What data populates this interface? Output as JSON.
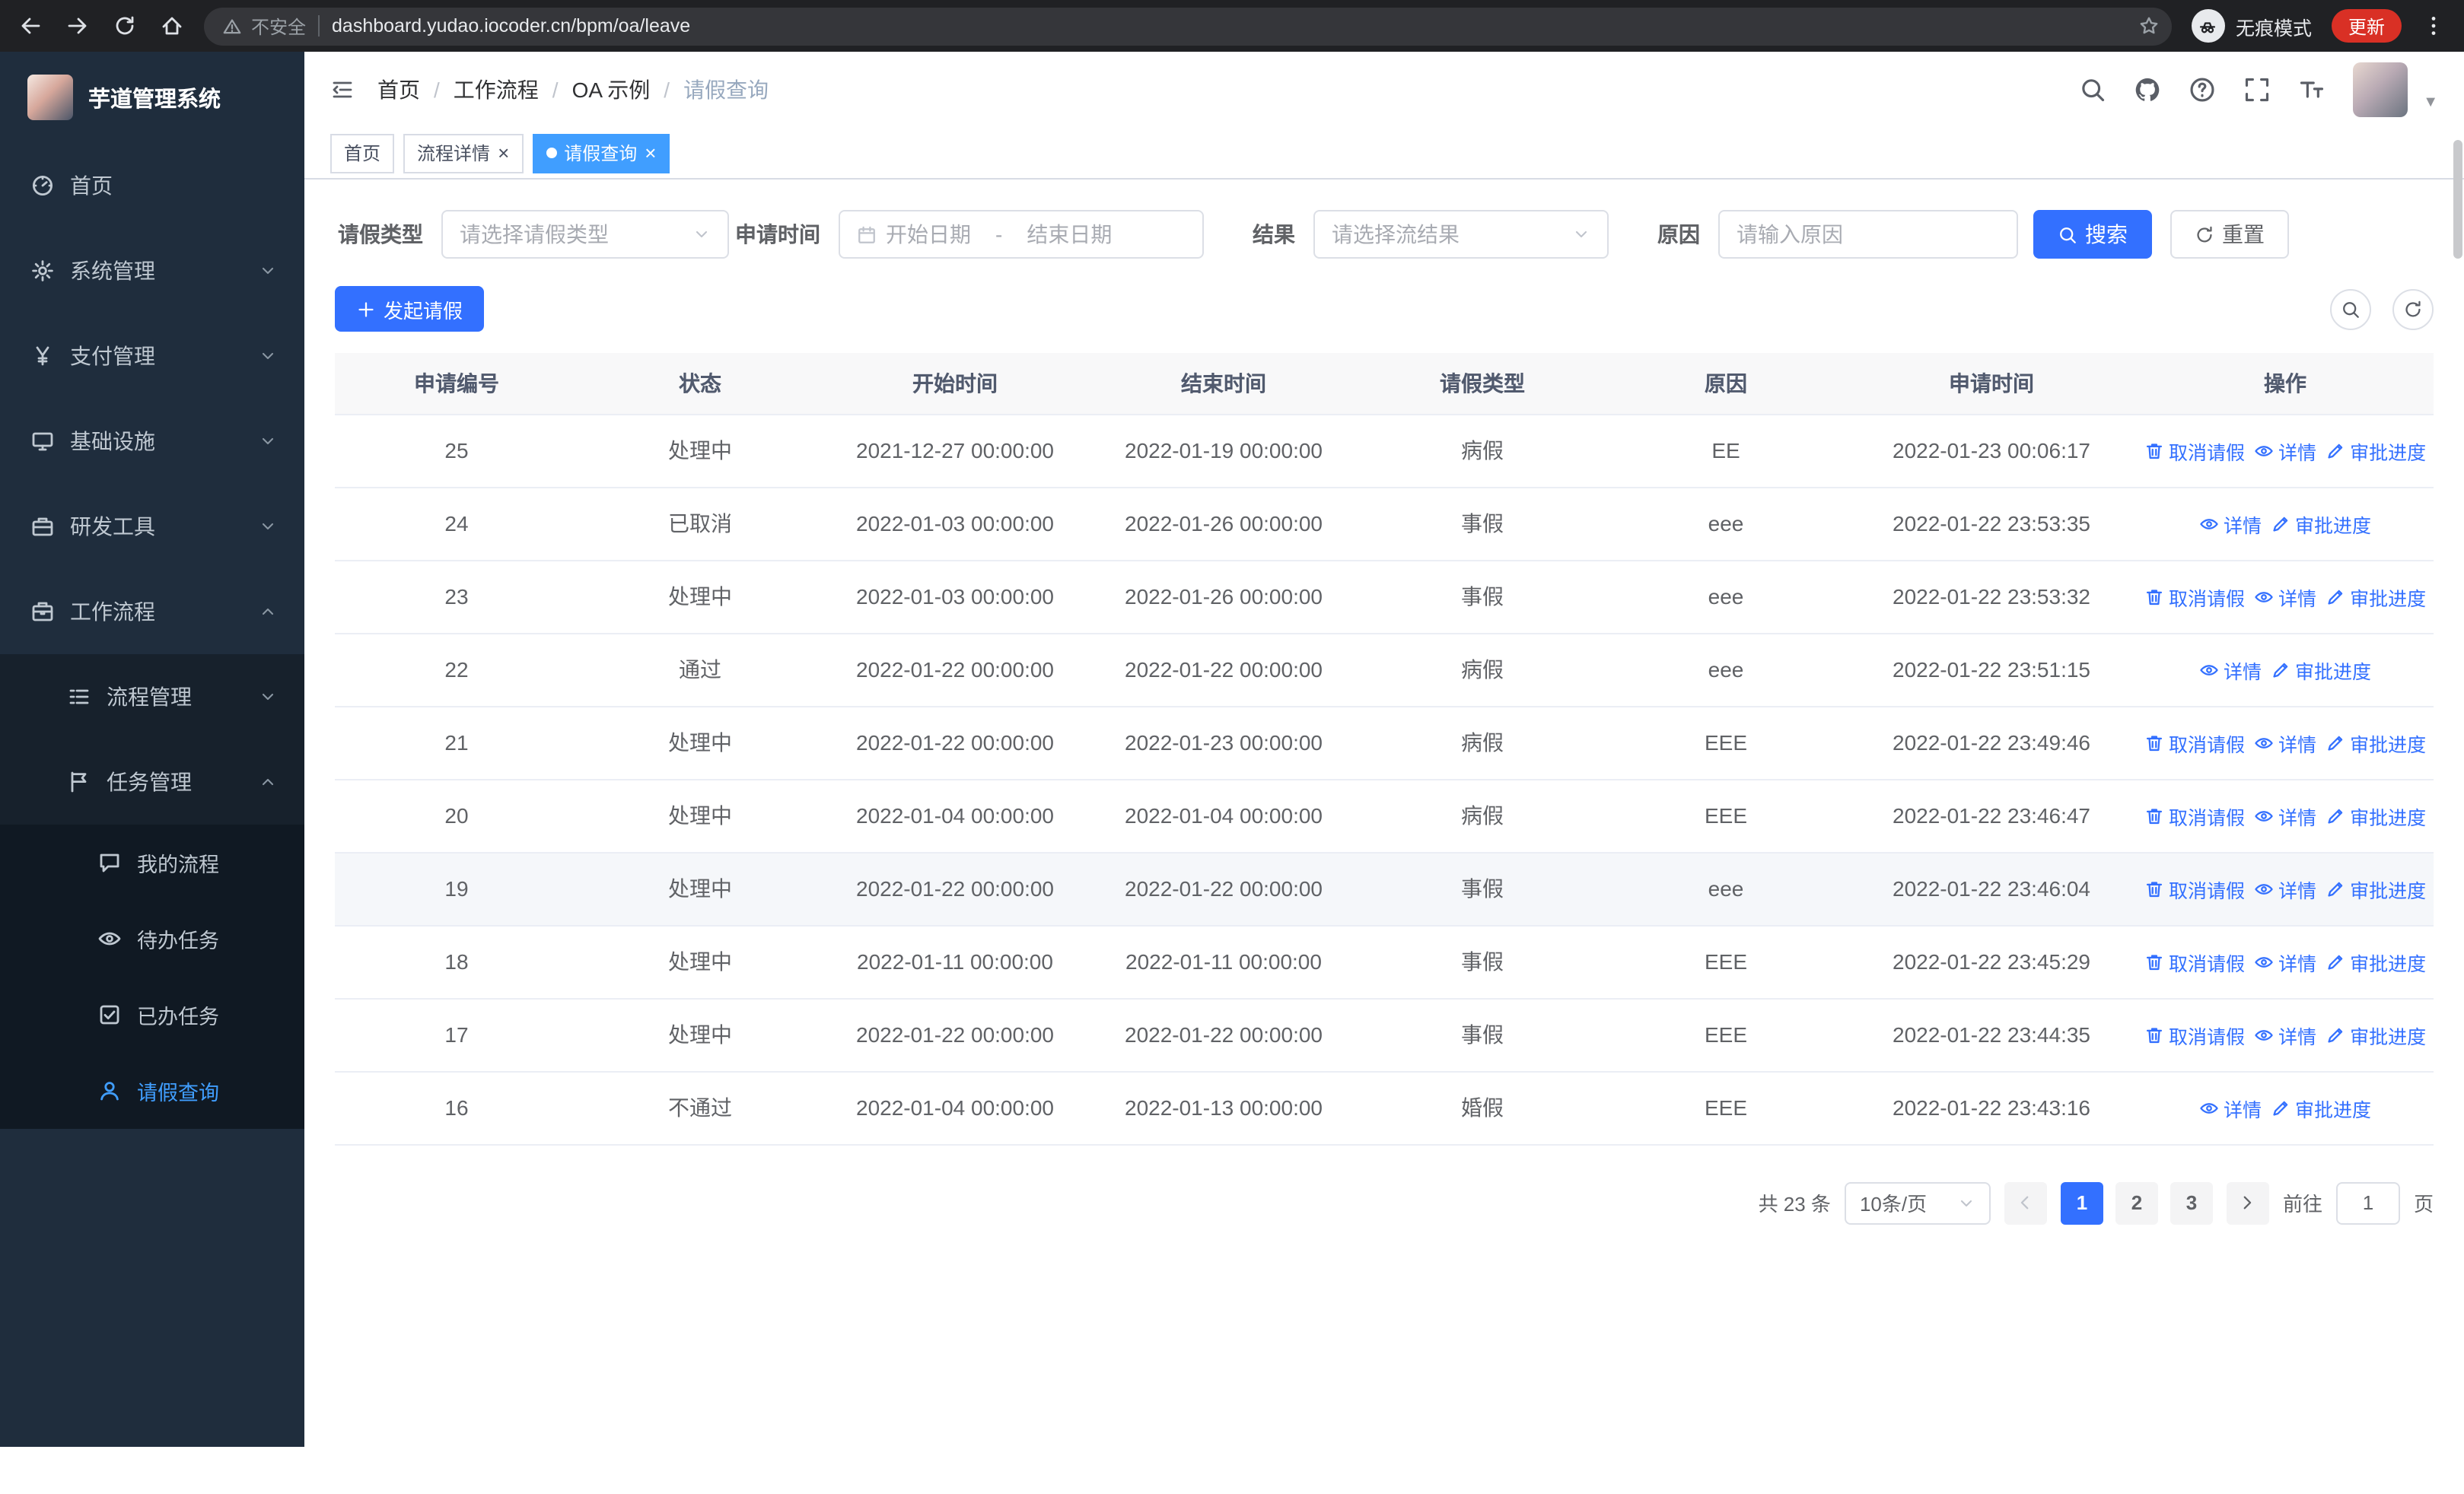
{
  "browser": {
    "security_label": "不安全",
    "url": "dashboard.yudao.iocoder.cn/bpm/oa/leave",
    "incognito_label": "无痕模式",
    "update_label": "更新"
  },
  "sidebar": {
    "logo_title": "芋道管理系统",
    "menu": [
      {
        "label": "首页",
        "icon": "gauge"
      },
      {
        "label": "系统管理",
        "icon": "gear",
        "chevron": "down"
      },
      {
        "label": "支付管理",
        "icon": "yen",
        "chevron": "down"
      },
      {
        "label": "基础设施",
        "icon": "monitor",
        "chevron": "down"
      },
      {
        "label": "研发工具",
        "icon": "tool",
        "chevron": "down"
      },
      {
        "label": "工作流程",
        "icon": "brief",
        "chevron": "up"
      }
    ],
    "submenu": [
      {
        "label": "流程管理",
        "icon": "flow",
        "chevron": "down"
      },
      {
        "label": "任务管理",
        "icon": "task",
        "chevron": "up"
      }
    ],
    "task_items": [
      {
        "label": "我的流程",
        "icon": "chat"
      },
      {
        "label": "待办任务",
        "icon": "eye"
      },
      {
        "label": "已办任务",
        "icon": "done"
      },
      {
        "label": "请假查询",
        "icon": "user",
        "active": true
      }
    ]
  },
  "header": {
    "breadcrumbs": [
      "首页",
      "工作流程",
      "OA 示例",
      "请假查询"
    ],
    "breadcrumb_separator": "/",
    "tabs": [
      {
        "label": "首页"
      },
      {
        "label": "流程详情",
        "closable": true
      },
      {
        "label": "请假查询",
        "closable": true,
        "active": true
      }
    ]
  },
  "filters": {
    "leave_type_label": "请假类型",
    "leave_type_placeholder": "请选择请假类型",
    "apply_time_label": "申请时间",
    "start_placeholder": "开始日期",
    "range_separator": "-",
    "end_placeholder": "结束日期",
    "result_label": "结果",
    "result_placeholder": "请选择流结果",
    "reason_label": "原因",
    "reason_placeholder": "请输入原因",
    "search_label": "搜索",
    "reset_label": "重置"
  },
  "toolbar": {
    "create_label": "发起请假"
  },
  "table": {
    "columns": [
      "申请编号",
      "状态",
      "开始时间",
      "结束时间",
      "请假类型",
      "原因",
      "申请时间",
      "操作"
    ],
    "action_labels": {
      "cancel": "取消请假",
      "detail": "详情",
      "progress": "审批进度"
    },
    "rows": [
      {
        "id": "25",
        "status": "处理中",
        "start": "2021-12-27 00:00:00",
        "end": "2022-01-19 00:00:00",
        "type": "病假",
        "reason": "EE",
        "applied": "2022-01-23 00:06:17",
        "actions": [
          "cancel",
          "detail",
          "progress"
        ]
      },
      {
        "id": "24",
        "status": "已取消",
        "start": "2022-01-03 00:00:00",
        "end": "2022-01-26 00:00:00",
        "type": "事假",
        "reason": "eee",
        "applied": "2022-01-22 23:53:35",
        "actions": [
          "detail",
          "progress"
        ]
      },
      {
        "id": "23",
        "status": "处理中",
        "start": "2022-01-03 00:00:00",
        "end": "2022-01-26 00:00:00",
        "type": "事假",
        "reason": "eee",
        "applied": "2022-01-22 23:53:32",
        "actions": [
          "cancel",
          "detail",
          "progress"
        ]
      },
      {
        "id": "22",
        "status": "通过",
        "start": "2022-01-22 00:00:00",
        "end": "2022-01-22 00:00:00",
        "type": "病假",
        "reason": "eee",
        "applied": "2022-01-22 23:51:15",
        "actions": [
          "detail",
          "progress"
        ]
      },
      {
        "id": "21",
        "status": "处理中",
        "start": "2022-01-22 00:00:00",
        "end": "2022-01-23 00:00:00",
        "type": "病假",
        "reason": "EEE",
        "applied": "2022-01-22 23:49:46",
        "actions": [
          "cancel",
          "detail",
          "progress"
        ]
      },
      {
        "id": "20",
        "status": "处理中",
        "start": "2022-01-04 00:00:00",
        "end": "2022-01-04 00:00:00",
        "type": "病假",
        "reason": "EEE",
        "applied": "2022-01-22 23:46:47",
        "actions": [
          "cancel",
          "detail",
          "progress"
        ]
      },
      {
        "id": "19",
        "status": "处理中",
        "start": "2022-01-22 00:00:00",
        "end": "2022-01-22 00:00:00",
        "type": "事假",
        "reason": "eee",
        "applied": "2022-01-22 23:46:04",
        "actions": [
          "cancel",
          "detail",
          "progress"
        ],
        "highlighted": true
      },
      {
        "id": "18",
        "status": "处理中",
        "start": "2022-01-11 00:00:00",
        "end": "2022-01-11 00:00:00",
        "type": "事假",
        "reason": "EEE",
        "applied": "2022-01-22 23:45:29",
        "actions": [
          "cancel",
          "detail",
          "progress"
        ]
      },
      {
        "id": "17",
        "status": "处理中",
        "start": "2022-01-22 00:00:00",
        "end": "2022-01-22 00:00:00",
        "type": "事假",
        "reason": "EEE",
        "applied": "2022-01-22 23:44:35",
        "actions": [
          "cancel",
          "detail",
          "progress"
        ]
      },
      {
        "id": "16",
        "status": "不通过",
        "start": "2022-01-04 00:00:00",
        "end": "2022-01-13 00:00:00",
        "type": "婚假",
        "reason": "EEE",
        "applied": "2022-01-22 23:43:16",
        "actions": [
          "detail",
          "progress"
        ]
      }
    ]
  },
  "pagination": {
    "total": "共 23 条",
    "page_size": "10条/页",
    "pages": [
      "1",
      "2",
      "3"
    ],
    "active": "1",
    "goto": "前往",
    "goto_value": "1",
    "unit": "页"
  }
}
